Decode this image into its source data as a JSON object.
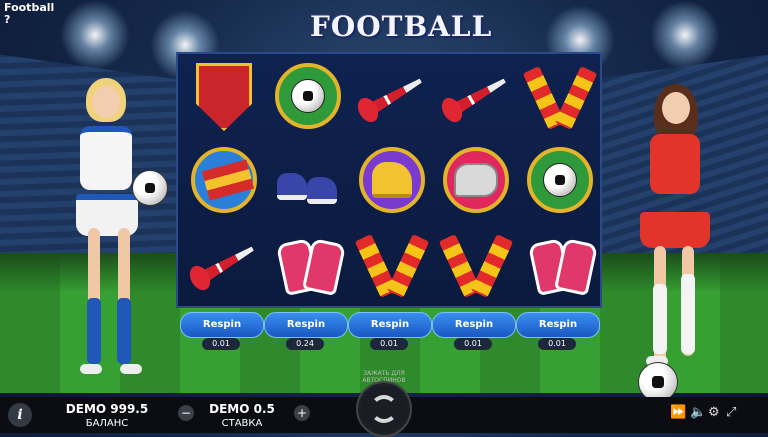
{
  "app": {
    "corner_title": "Football",
    "corner_help": "?"
  },
  "logo": {
    "text": "FOOTBALL"
  },
  "reels": {
    "rows": [
      [
        "pennant",
        "ball-medal",
        "vuvuzela",
        "vuvuzela",
        "scarf"
      ],
      [
        "flags-medal",
        "sneakers",
        "golden-boot-medal",
        "whistle-medal",
        "ball-medal"
      ],
      [
        "vuvuzela",
        "gloves",
        "scarf",
        "scarf",
        "gloves"
      ]
    ]
  },
  "respin": {
    "label": "Respin",
    "prices": [
      "0.01",
      "0.24",
      "0.01",
      "0.01",
      "0.01"
    ]
  },
  "footer": {
    "balance_value": "DEMO 999.5",
    "balance_label": "БАЛАНС",
    "bet_value": "DEMO 0.5",
    "bet_label": "СТАВКА",
    "minus": "−",
    "plus": "+",
    "info": "i",
    "autospin_hint": "ЗАЖАТЬ ДЛЯ АВТОСПИНОВ",
    "icons": [
      "fast-forward-icon",
      "sound-icon",
      "settings-icon",
      "fullscreen-icon"
    ]
  },
  "colors": {
    "accent": "#2a6fe0",
    "reel_bg": "#0f2250",
    "bar": "#0b0d12"
  }
}
